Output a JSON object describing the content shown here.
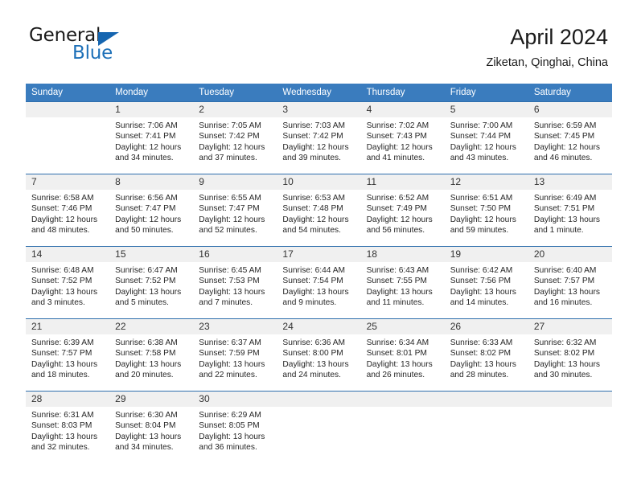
{
  "brand": {
    "name_part1": "General",
    "name_part2": "Blue",
    "logo_icon": "triangle-flag-icon"
  },
  "header": {
    "title": "April 2024",
    "location": "Ziketan, Qinghai, China"
  },
  "calendar": {
    "weekday_headers": [
      "Sunday",
      "Monday",
      "Tuesday",
      "Wednesday",
      "Thursday",
      "Friday",
      "Saturday"
    ],
    "accent_color": "#3a7cbe",
    "border_color": "#2f6fad",
    "daynum_bg": "#f0f0f0",
    "weeks": [
      [
        {
          "day": "",
          "lines": []
        },
        {
          "day": "1",
          "lines": [
            "Sunrise: 7:06 AM",
            "Sunset: 7:41 PM",
            "Daylight: 12 hours",
            "and 34 minutes."
          ]
        },
        {
          "day": "2",
          "lines": [
            "Sunrise: 7:05 AM",
            "Sunset: 7:42 PM",
            "Daylight: 12 hours",
            "and 37 minutes."
          ]
        },
        {
          "day": "3",
          "lines": [
            "Sunrise: 7:03 AM",
            "Sunset: 7:42 PM",
            "Daylight: 12 hours",
            "and 39 minutes."
          ]
        },
        {
          "day": "4",
          "lines": [
            "Sunrise: 7:02 AM",
            "Sunset: 7:43 PM",
            "Daylight: 12 hours",
            "and 41 minutes."
          ]
        },
        {
          "day": "5",
          "lines": [
            "Sunrise: 7:00 AM",
            "Sunset: 7:44 PM",
            "Daylight: 12 hours",
            "and 43 minutes."
          ]
        },
        {
          "day": "6",
          "lines": [
            "Sunrise: 6:59 AM",
            "Sunset: 7:45 PM",
            "Daylight: 12 hours",
            "and 46 minutes."
          ]
        }
      ],
      [
        {
          "day": "7",
          "lines": [
            "Sunrise: 6:58 AM",
            "Sunset: 7:46 PM",
            "Daylight: 12 hours",
            "and 48 minutes."
          ]
        },
        {
          "day": "8",
          "lines": [
            "Sunrise: 6:56 AM",
            "Sunset: 7:47 PM",
            "Daylight: 12 hours",
            "and 50 minutes."
          ]
        },
        {
          "day": "9",
          "lines": [
            "Sunrise: 6:55 AM",
            "Sunset: 7:47 PM",
            "Daylight: 12 hours",
            "and 52 minutes."
          ]
        },
        {
          "day": "10",
          "lines": [
            "Sunrise: 6:53 AM",
            "Sunset: 7:48 PM",
            "Daylight: 12 hours",
            "and 54 minutes."
          ]
        },
        {
          "day": "11",
          "lines": [
            "Sunrise: 6:52 AM",
            "Sunset: 7:49 PM",
            "Daylight: 12 hours",
            "and 56 minutes."
          ]
        },
        {
          "day": "12",
          "lines": [
            "Sunrise: 6:51 AM",
            "Sunset: 7:50 PM",
            "Daylight: 12 hours",
            "and 59 minutes."
          ]
        },
        {
          "day": "13",
          "lines": [
            "Sunrise: 6:49 AM",
            "Sunset: 7:51 PM",
            "Daylight: 13 hours",
            "and 1 minute."
          ]
        }
      ],
      [
        {
          "day": "14",
          "lines": [
            "Sunrise: 6:48 AM",
            "Sunset: 7:52 PM",
            "Daylight: 13 hours",
            "and 3 minutes."
          ]
        },
        {
          "day": "15",
          "lines": [
            "Sunrise: 6:47 AM",
            "Sunset: 7:52 PM",
            "Daylight: 13 hours",
            "and 5 minutes."
          ]
        },
        {
          "day": "16",
          "lines": [
            "Sunrise: 6:45 AM",
            "Sunset: 7:53 PM",
            "Daylight: 13 hours",
            "and 7 minutes."
          ]
        },
        {
          "day": "17",
          "lines": [
            "Sunrise: 6:44 AM",
            "Sunset: 7:54 PM",
            "Daylight: 13 hours",
            "and 9 minutes."
          ]
        },
        {
          "day": "18",
          "lines": [
            "Sunrise: 6:43 AM",
            "Sunset: 7:55 PM",
            "Daylight: 13 hours",
            "and 11 minutes."
          ]
        },
        {
          "day": "19",
          "lines": [
            "Sunrise: 6:42 AM",
            "Sunset: 7:56 PM",
            "Daylight: 13 hours",
            "and 14 minutes."
          ]
        },
        {
          "day": "20",
          "lines": [
            "Sunrise: 6:40 AM",
            "Sunset: 7:57 PM",
            "Daylight: 13 hours",
            "and 16 minutes."
          ]
        }
      ],
      [
        {
          "day": "21",
          "lines": [
            "Sunrise: 6:39 AM",
            "Sunset: 7:57 PM",
            "Daylight: 13 hours",
            "and 18 minutes."
          ]
        },
        {
          "day": "22",
          "lines": [
            "Sunrise: 6:38 AM",
            "Sunset: 7:58 PM",
            "Daylight: 13 hours",
            "and 20 minutes."
          ]
        },
        {
          "day": "23",
          "lines": [
            "Sunrise: 6:37 AM",
            "Sunset: 7:59 PM",
            "Daylight: 13 hours",
            "and 22 minutes."
          ]
        },
        {
          "day": "24",
          "lines": [
            "Sunrise: 6:36 AM",
            "Sunset: 8:00 PM",
            "Daylight: 13 hours",
            "and 24 minutes."
          ]
        },
        {
          "day": "25",
          "lines": [
            "Sunrise: 6:34 AM",
            "Sunset: 8:01 PM",
            "Daylight: 13 hours",
            "and 26 minutes."
          ]
        },
        {
          "day": "26",
          "lines": [
            "Sunrise: 6:33 AM",
            "Sunset: 8:02 PM",
            "Daylight: 13 hours",
            "and 28 minutes."
          ]
        },
        {
          "day": "27",
          "lines": [
            "Sunrise: 6:32 AM",
            "Sunset: 8:02 PM",
            "Daylight: 13 hours",
            "and 30 minutes."
          ]
        }
      ],
      [
        {
          "day": "28",
          "lines": [
            "Sunrise: 6:31 AM",
            "Sunset: 8:03 PM",
            "Daylight: 13 hours",
            "and 32 minutes."
          ]
        },
        {
          "day": "29",
          "lines": [
            "Sunrise: 6:30 AM",
            "Sunset: 8:04 PM",
            "Daylight: 13 hours",
            "and 34 minutes."
          ]
        },
        {
          "day": "30",
          "lines": [
            "Sunrise: 6:29 AM",
            "Sunset: 8:05 PM",
            "Daylight: 13 hours",
            "and 36 minutes."
          ]
        },
        {
          "day": "",
          "lines": []
        },
        {
          "day": "",
          "lines": []
        },
        {
          "day": "",
          "lines": []
        },
        {
          "day": "",
          "lines": []
        }
      ]
    ]
  }
}
